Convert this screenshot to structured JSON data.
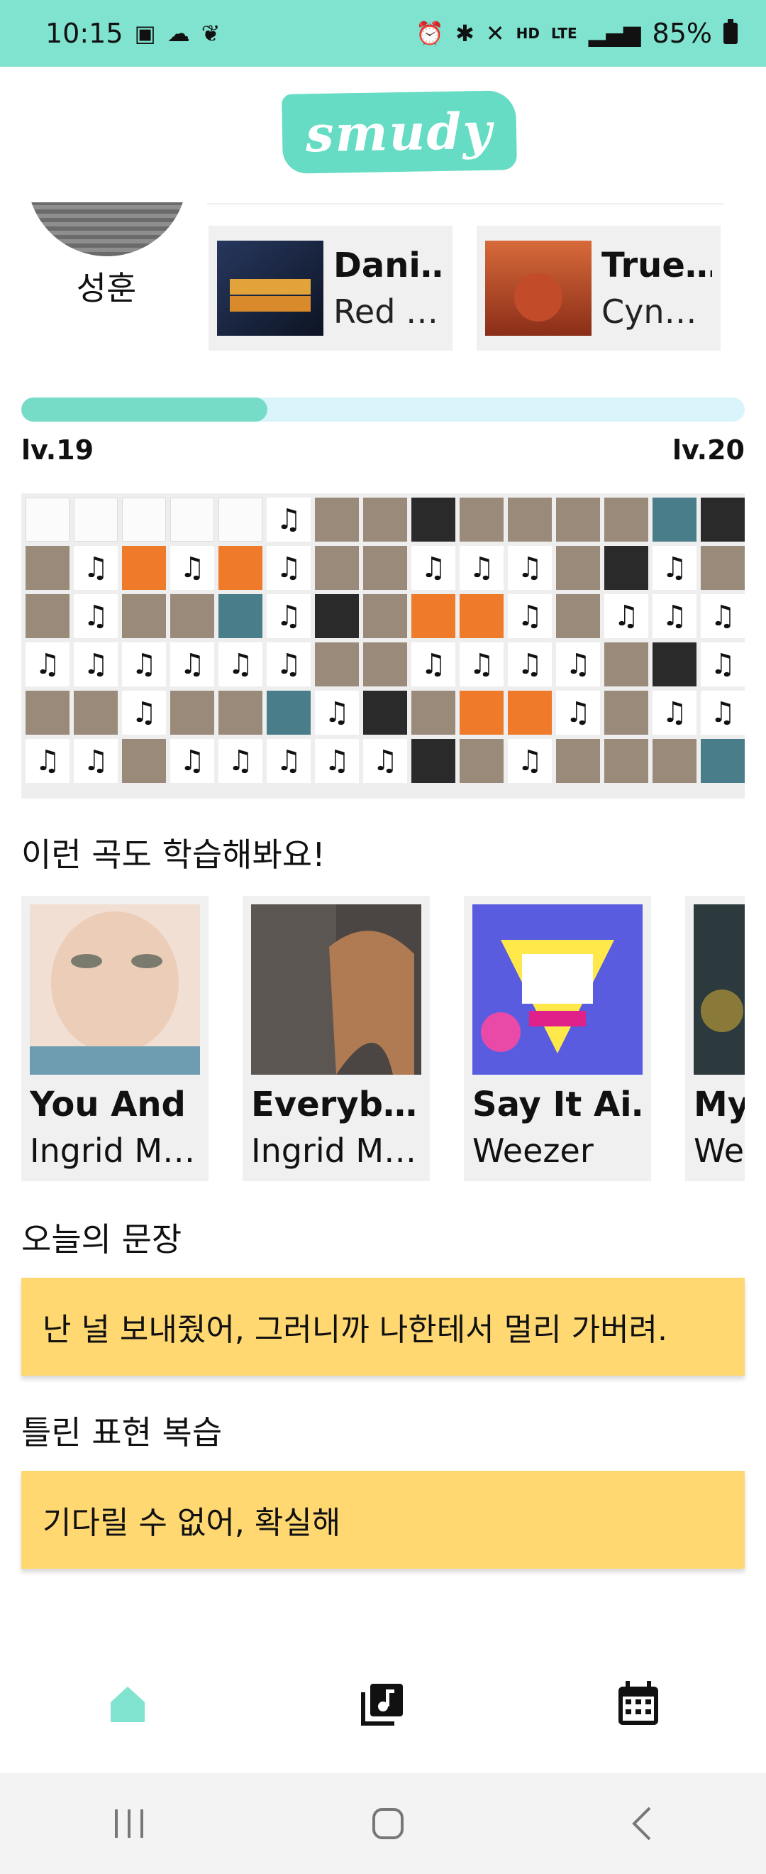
{
  "status_bar": {
    "time": "10:15",
    "battery": "85%",
    "hd_label": "HD",
    "lte_label": "LTE"
  },
  "app": {
    "logo": "smudy",
    "accent": "#7fe3cf"
  },
  "profile": {
    "name": "성훈"
  },
  "favorites": [
    {
      "title": "Dani…",
      "artist": "Red …"
    },
    {
      "title": "True…",
      "artist": "Cyn…"
    }
  ],
  "progress": {
    "fraction": 0.34,
    "current_level": "lv.19",
    "next_level": "lv.20"
  },
  "grid_note_icon": "♫",
  "recommend": {
    "title": "이런 곡도 학습해봐요!",
    "items": [
      {
        "title": "You And I",
        "artist": "Ingrid M…"
      },
      {
        "title": "Everyb…",
        "artist": "Ingrid M…"
      },
      {
        "title": "Say It Ai…",
        "artist": "Weezer"
      },
      {
        "title": "My",
        "artist": "We"
      }
    ]
  },
  "today": {
    "title": "오늘의 문장",
    "sentence": "난 널 보내줬어, 그러니까 나한테서 멀리 가버려."
  },
  "review": {
    "title": "틀린 표현 복습",
    "sentence": "기다릴 수 없어, 확실해"
  },
  "nav": {
    "items": [
      "home-icon",
      "music-library-icon",
      "calendar-icon"
    ]
  }
}
